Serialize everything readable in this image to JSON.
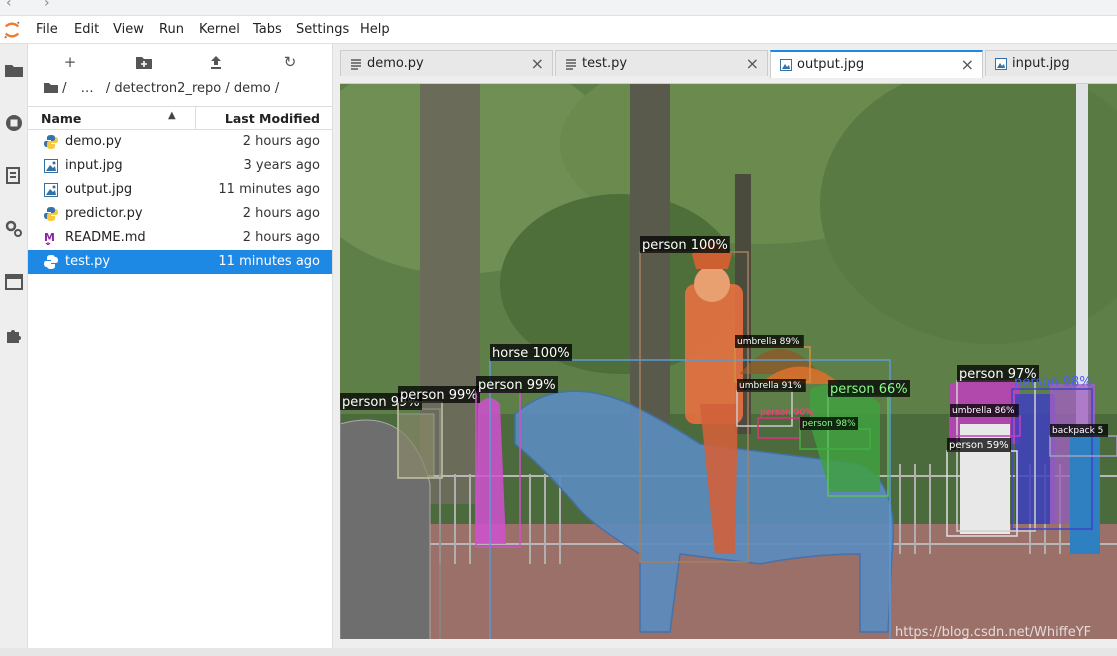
{
  "menu": [
    "File",
    "Edit",
    "View",
    "Run",
    "Kernel",
    "Tabs",
    "Settings",
    "Help"
  ],
  "filebrowser": {
    "breadcrumb": [
      "/",
      "…",
      "/ detectron2_repo / demo /"
    ],
    "header": {
      "name": "Name",
      "modified": "Last Modified"
    },
    "files": [
      {
        "name": "demo.py",
        "modified": "2 hours ago",
        "icon": "python-file-icon"
      },
      {
        "name": "input.jpg",
        "modified": "3 years ago",
        "icon": "image-file-icon"
      },
      {
        "name": "output.jpg",
        "modified": "11 minutes ago",
        "icon": "image-file-icon"
      },
      {
        "name": "predictor.py",
        "modified": "2 hours ago",
        "icon": "python-file-icon"
      },
      {
        "name": "README.md",
        "modified": "2 hours ago",
        "icon": "markdown-file-icon"
      },
      {
        "name": "test.py",
        "modified": "11 minutes ago",
        "icon": "python-file-icon",
        "selected": true
      }
    ]
  },
  "tabs": [
    {
      "label": "demo.py",
      "icon": "text-file-icon",
      "active": false
    },
    {
      "label": "test.py",
      "icon": "text-file-icon",
      "active": false
    },
    {
      "label": "output.jpg",
      "icon": "image-file-icon",
      "active": true
    },
    {
      "label": "input.jpg",
      "icon": "image-file-icon",
      "active": false
    }
  ],
  "detections": [
    {
      "label": "person 100%"
    },
    {
      "label": "horse 100%"
    },
    {
      "label": "person 99%"
    },
    {
      "label": "person 99%"
    },
    {
      "label": "person 99%"
    },
    {
      "label": "umbrella 89%"
    },
    {
      "label": "umbrella 91%"
    },
    {
      "label": "person 90%"
    },
    {
      "label": "person 66%"
    },
    {
      "label": "person 98%"
    },
    {
      "label": "person 97%"
    },
    {
      "label": "person 98%"
    },
    {
      "label": "umbrella 86%"
    },
    {
      "label": "person 59%"
    },
    {
      "label": "backpack 5"
    }
  ],
  "watermark": "https://blog.csdn.net/WhiffeYF",
  "colors": {
    "accent": "#1e88e5",
    "python": "#3572A5",
    "markdown": "#8e24aa"
  }
}
